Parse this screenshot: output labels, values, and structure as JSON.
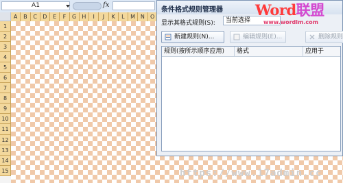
{
  "formula_bar": {
    "name_box": "A1",
    "fx": "fx"
  },
  "sheet": {
    "columns": [
      "A",
      "B",
      "C",
      "D",
      "E",
      "F",
      "G",
      "H",
      "I",
      "J",
      "K",
      "L",
      "M",
      "N",
      "O"
    ],
    "rows": [
      "1",
      "2",
      "3",
      "4",
      "5",
      "6",
      "7",
      "8",
      "9",
      "10",
      "11",
      "12",
      "13",
      "14",
      "15"
    ]
  },
  "dialog": {
    "title": "条件格式规则管理器",
    "show_rules_label": "显示其格式规则(S):",
    "show_rules_value": "当前选择",
    "buttons": {
      "new_rule": "新建规则(N)...",
      "edit_rule": "编辑规则(E)...",
      "delete_rule": "删除规则"
    },
    "table_headers": [
      "规则(按所示顺序应用)",
      "格式",
      "应用于"
    ]
  },
  "watermark": {
    "logo_word": "Word",
    "logo_cn": "联盟",
    "logo_url": "www.wordlm.com",
    "footer": "https://www.17admin.cc"
  },
  "colors": {
    "checker": "#f0c9a9",
    "header": "#f3d89c",
    "logo": "#ff3a3a"
  }
}
